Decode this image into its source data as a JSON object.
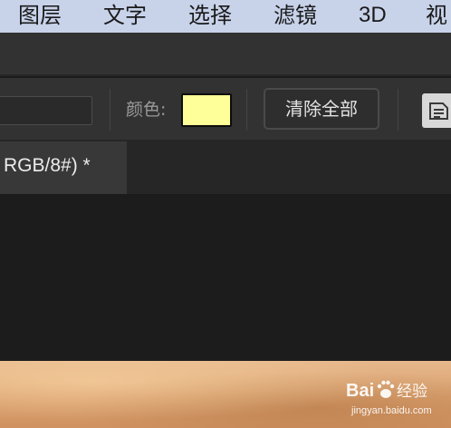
{
  "menubar": {
    "items": [
      "图层",
      "文字",
      "选择",
      "滤镜",
      "3D",
      "视"
    ]
  },
  "options": {
    "color_label": "颜色:",
    "color_value": "#ffff99",
    "clear_all_label": "清除全部"
  },
  "document_tab": {
    "title": "RGB/8#) *"
  },
  "watermark": {
    "main": "Bai",
    "main_suffix": "经验",
    "sub": "jingyan.baidu.com"
  }
}
